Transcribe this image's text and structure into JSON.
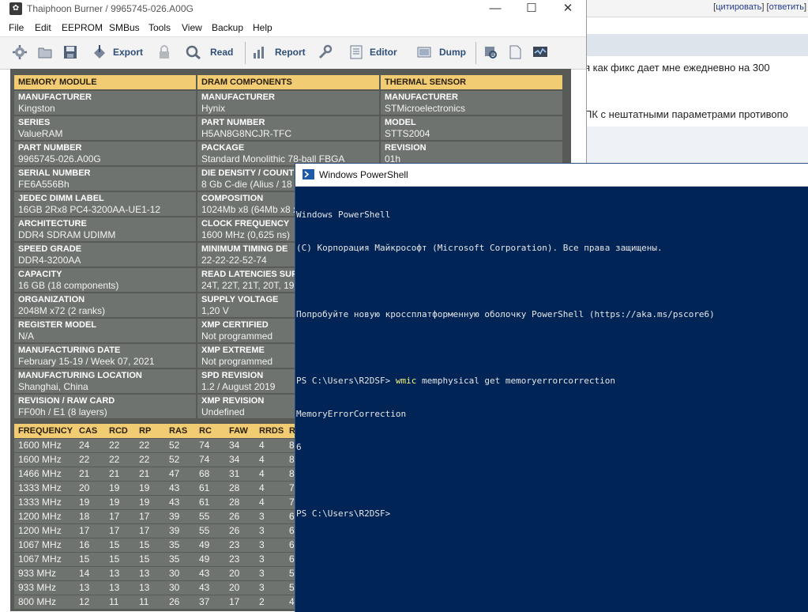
{
  "forum": {
    "links_prefix": "[",
    "link_quote": "цитировать",
    "links_mid": "] [",
    "link_reply": "ответить",
    "links_suffix": "]",
    "line1": "я как фикс дает мне ежедневно на 300 ",
    "line2": "ПК с нештатными параметрами противопо"
  },
  "thaiphoon": {
    "title": "Thaiphoon Burner / 9965745-026.A00G",
    "window_buttons": {
      "minimize": "—",
      "maximize": "☐",
      "close": "✕"
    },
    "menu": [
      "File",
      "Edit",
      "EEPROM",
      "SMBus",
      "Tools",
      "View",
      "Backup",
      "Help"
    ],
    "toolbar": {
      "export": "Export",
      "read": "Read",
      "report": "Report",
      "editor": "Editor",
      "dump": "Dump"
    },
    "columns": [
      {
        "header": "MEMORY MODULE",
        "fields": [
          {
            "label": "MANUFACTURER",
            "value": "Kingston"
          },
          {
            "label": "SERIES",
            "value": "ValueRAM"
          },
          {
            "label": "PART NUMBER",
            "value": "9965745-026.A00G"
          },
          {
            "label": "SERIAL NUMBER",
            "value": "FE6A556Bh"
          },
          {
            "label": "JEDEC DIMM LABEL",
            "value": "16GB 2Rx8 PC4-3200AA-UE1-12"
          },
          {
            "label": "ARCHITECTURE",
            "value": "DDR4 SDRAM UDIMM"
          },
          {
            "label": "SPEED GRADE",
            "value": "DDR4-3200AA"
          },
          {
            "label": "CAPACITY",
            "value": "16 GB (18 components)"
          },
          {
            "label": "ORGANIZATION",
            "value": "2048M x72 (2 ranks)"
          },
          {
            "label": "REGISTER MODEL",
            "value": "N/A"
          },
          {
            "label": "MANUFACTURING DATE",
            "value": "February 15-19 / Week 07, 2021"
          },
          {
            "label": "MANUFACTURING LOCATION",
            "value": "Shanghai, China"
          },
          {
            "label": "REVISION / RAW CARD",
            "value": "FF00h / E1 (8 layers)"
          }
        ]
      },
      {
        "header": "DRAM COMPONENTS",
        "fields": [
          {
            "label": "MANUFACTURER",
            "value": "Hynix"
          },
          {
            "label": "PART NUMBER",
            "value": "H5AN8G8NCJR-TFC"
          },
          {
            "label": "PACKAGE",
            "value": "Standard Monolithic 78-ball FBGA"
          },
          {
            "label": "DIE DENSITY / COUNT",
            "value": "8 Gb C-die (Alius / 18"
          },
          {
            "label": "COMPOSITION",
            "value": "1024Mb x8 (64Mb x8 x"
          },
          {
            "label": "CLOCK FREQUENCY",
            "value": "1600 MHz (0,625 ns)"
          },
          {
            "label": "MINIMUM TIMING DE",
            "value": "22-22-22-52-74"
          },
          {
            "label": "READ LATENCIES SUP",
            "value": "24T, 22T, 21T, 20T, 19"
          },
          {
            "label": "SUPPLY VOLTAGE",
            "value": "1,20 V"
          },
          {
            "label": "XMP CERTIFIED",
            "value": "Not programmed"
          },
          {
            "label": "XMP EXTREME",
            "value": "Not programmed"
          },
          {
            "label": "SPD REVISION",
            "value": "1.2 / August 2019"
          },
          {
            "label": "XMP REVISION",
            "value": "Undefined"
          }
        ]
      },
      {
        "header": "THERMAL SENSOR",
        "fields": [
          {
            "label": "MANUFACTURER",
            "value": "STMicroelectronics"
          },
          {
            "label": "MODEL",
            "value": "STTS2004"
          },
          {
            "label": "REVISION",
            "value": "01h"
          }
        ]
      }
    ],
    "freq_table": {
      "headers": [
        "FREQUENCY",
        "CAS",
        "RCD",
        "RP",
        "RAS",
        "RC",
        "FAW",
        "RRDS",
        "R"
      ],
      "rows": [
        [
          "1600 MHz",
          "24",
          "22",
          "22",
          "52",
          "74",
          "34",
          "4",
          "8"
        ],
        [
          "1600 MHz",
          "22",
          "22",
          "22",
          "52",
          "74",
          "34",
          "4",
          "8"
        ],
        [
          "1466 MHz",
          "21",
          "21",
          "21",
          "47",
          "68",
          "31",
          "4",
          "8"
        ],
        [
          "1333 MHz",
          "20",
          "19",
          "19",
          "43",
          "61",
          "28",
          "4",
          "7"
        ],
        [
          "1333 MHz",
          "19",
          "19",
          "19",
          "43",
          "61",
          "28",
          "4",
          "7"
        ],
        [
          "1200 MHz",
          "18",
          "17",
          "17",
          "39",
          "55",
          "26",
          "3",
          "6"
        ],
        [
          "1200 MHz",
          "17",
          "17",
          "17",
          "39",
          "55",
          "26",
          "3",
          "6"
        ],
        [
          "1067 MHz",
          "16",
          "15",
          "15",
          "35",
          "49",
          "23",
          "3",
          "6"
        ],
        [
          "1067 MHz",
          "15",
          "15",
          "15",
          "35",
          "49",
          "23",
          "3",
          "6"
        ],
        [
          "933 MHz",
          "14",
          "13",
          "13",
          "30",
          "43",
          "20",
          "3",
          "5"
        ],
        [
          "933 MHz",
          "13",
          "13",
          "13",
          "30",
          "43",
          "20",
          "3",
          "5"
        ],
        [
          "800 MHz",
          "12",
          "11",
          "11",
          "26",
          "37",
          "17",
          "2",
          "4"
        ]
      ]
    }
  },
  "powershell": {
    "title": "Windows PowerShell",
    "lines": [
      "Windows PowerShell",
      "(C) Корпорация Майкрософт (Microsoft Corporation). Все права защищены.",
      "",
      "Попробуйте новую кроссплатформенную оболочку PowerShell (https://aka.ms/pscore6)",
      "",
      "",
      "MemoryErrorCorrection",
      "6",
      "",
      "PS C:\\Users\\R2DSF>"
    ],
    "prompt": "PS C:\\Users\\R2DSF> ",
    "command": "wmic",
    "command_args": " memphysical get memoryerrorcorrection"
  }
}
